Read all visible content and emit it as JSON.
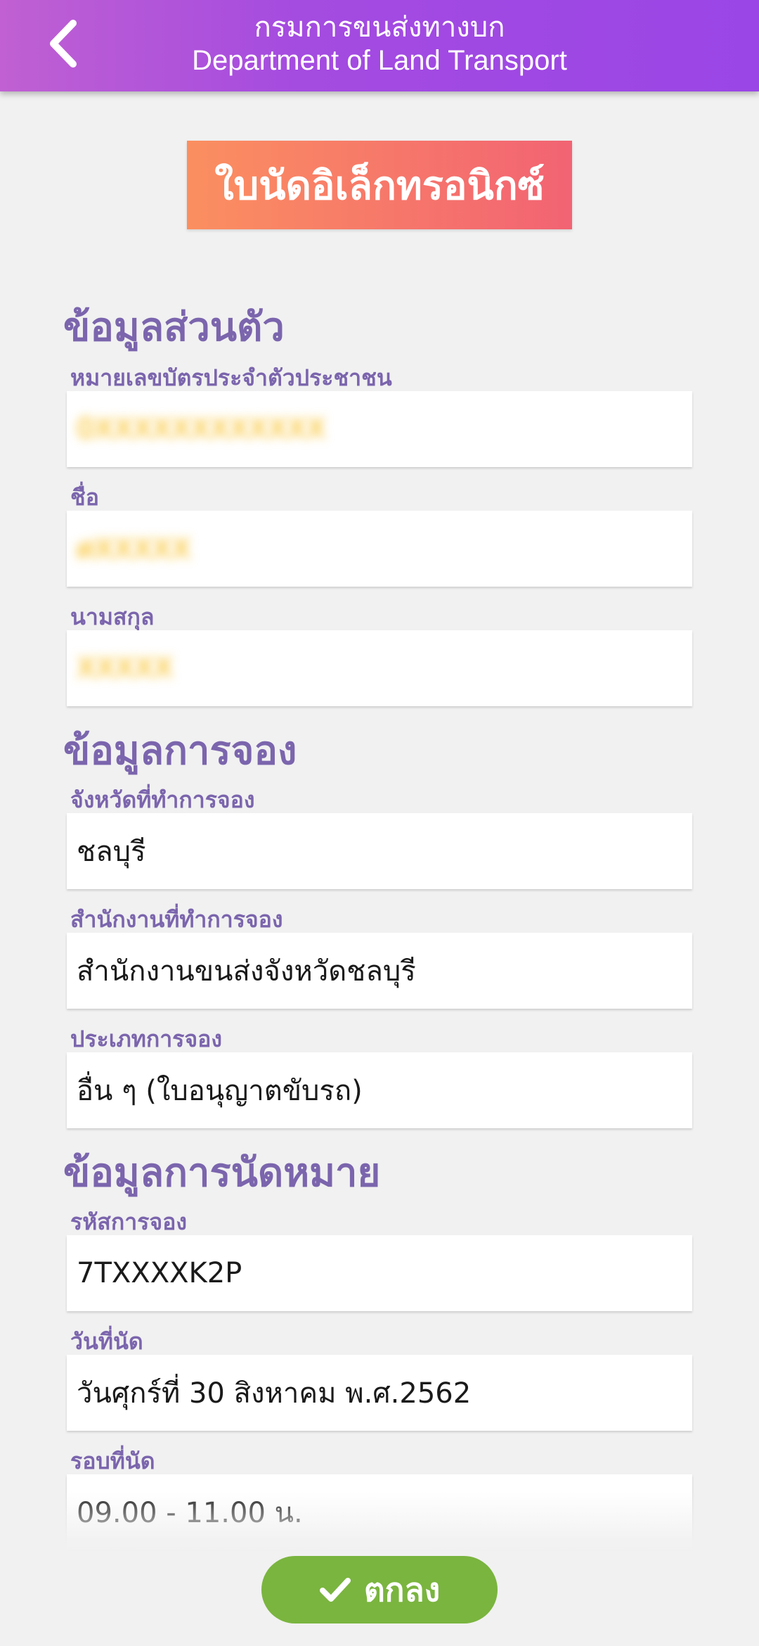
{
  "header": {
    "title_th": "กรมการขนส่งทางบก",
    "title_en": "Department of Land Transport"
  },
  "document_title": "ใบนัดอิเล็กทรอนิกซ์",
  "personal": {
    "section_title": "ข้อมูลส่วนตัว",
    "id_label": "หมายเลขบัตรประจำตัวประชาชน",
    "id_value": "0XXXXXXXXXXXX",
    "name_label": "ชื่อ",
    "name_value": "ศXXXXX",
    "surname_label": "นามสกุล",
    "surname_value": "XXXXX"
  },
  "booking": {
    "section_title": "ข้อมูลการจอง",
    "province_label": "จังหวัดที่ทำการจอง",
    "province_value": "ชลบุรี",
    "office_label": "สำนักงานที่ทำการจอง",
    "office_value": "สำนักงานขนส่งจังหวัดชลบุรี",
    "type_label": "ประเภทการจอง",
    "type_value": "อื่น ๆ (ใบอนุญาตขับรถ)"
  },
  "appointment": {
    "section_title": "ข้อมูลการนัดหมาย",
    "code_label": "รหัสการจอง",
    "code_value": "7TXXXXK2P",
    "date_label": "วันที่นัด",
    "date_value": "วันศุกร์ที่ 30 สิงหาคม พ.ศ.2562",
    "round_label": "รอบที่นัด",
    "round_value": "09.00 - 11.00 น."
  },
  "ok_button": {
    "label": "ตกลง",
    "icon": "check-icon",
    "color": "#7ab53f"
  },
  "colors": {
    "header_gradient_start": "#c060d2",
    "header_gradient_end": "#9a45e6",
    "label_color": "#7b65ad",
    "title_gradient_start": "#fb8f60",
    "title_gradient_end": "#f26373"
  }
}
